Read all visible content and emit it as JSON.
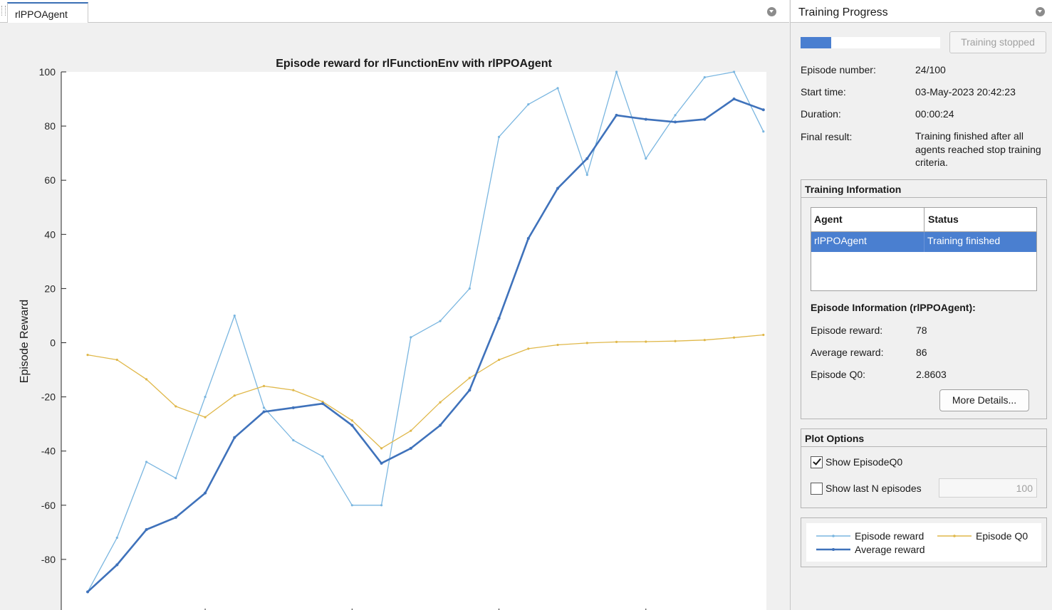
{
  "document": {
    "tab_label": "rlPPOAgent"
  },
  "chart_data": {
    "type": "line",
    "title": "Episode reward for rlFunctionEnv with rlPPOAgent",
    "xlabel": "",
    "ylabel": "Episode Reward",
    "ylim": [
      -100,
      100
    ],
    "xlim": [
      0,
      24
    ],
    "yticks": [
      100,
      80,
      60,
      40,
      20,
      0,
      -20,
      -40,
      -60,
      -80,
      -100
    ],
    "grid": false,
    "x": [
      1,
      2,
      3,
      4,
      5,
      6,
      7,
      8,
      9,
      10,
      11,
      12,
      13,
      14,
      15,
      16,
      17,
      18,
      19,
      20,
      21,
      22,
      23,
      24
    ],
    "series": [
      {
        "name": "Episode reward",
        "color": "#7ab6e0",
        "width": 1.3,
        "values": [
          -92,
          -72,
          -44,
          -50,
          -20,
          10,
          -24,
          -36,
          -42,
          -60,
          -60,
          2,
          8,
          20,
          76,
          88,
          94,
          62,
          100,
          68,
          84,
          98,
          100,
          78
        ]
      },
      {
        "name": "Average reward",
        "color": "#3f72bb",
        "width": 2.6,
        "values": [
          -92,
          -82,
          -69,
          -64.5,
          -55.5,
          -35,
          -25.5,
          -24,
          -22.5,
          -30.5,
          -44.5,
          -39,
          -30.5,
          -17.5,
          9,
          38.5,
          57,
          68,
          84,
          82.5,
          81.5,
          82.5,
          90,
          86
        ]
      },
      {
        "name": "Episode Q0",
        "color": "#e0b84a",
        "width": 1.3,
        "values": [
          -4.5,
          -6.3,
          -13.5,
          -23.5,
          -27.5,
          -19.5,
          -16,
          -17.5,
          -21.8,
          -28.7,
          -39,
          -32.5,
          -22,
          -13,
          -6.3,
          -2.2,
          -0.8,
          -0.1,
          0.3,
          0.4,
          0.6,
          1,
          1.9,
          2.9
        ]
      }
    ]
  },
  "training_progress": {
    "title": "Training Progress",
    "progress_fraction": 0.24,
    "stop_button_label": "Training stopped",
    "episode_number_label": "Episode number:",
    "episode_number_value": "24/100",
    "start_time_label": "Start time:",
    "start_time_value": "03-May-2023 20:42:23",
    "duration_label": "Duration:",
    "duration_value": "00:00:24",
    "final_result_label": "Final result:",
    "final_result_value": "Training finished after all agents reached stop training criteria."
  },
  "training_information": {
    "title": "Training Information",
    "columns": [
      "Agent",
      "Status"
    ],
    "rows": [
      {
        "agent": "rlPPOAgent",
        "status": "Training finished"
      }
    ],
    "episode_info_title": "Episode Information (rlPPOAgent):",
    "episode_reward_label": "Episode reward:",
    "episode_reward_value": "78",
    "average_reward_label": "Average reward:",
    "average_reward_value": "86",
    "episode_q0_label": "Episode Q0:",
    "episode_q0_value": "2.8603",
    "more_details_label": "More Details..."
  },
  "plot_options": {
    "title": "Plot Options",
    "show_q0_label": "Show EpisodeQ0",
    "show_q0_checked": true,
    "show_last_n_label": "Show last N episodes",
    "show_last_n_checked": false,
    "last_n_value": "100"
  },
  "legend": {
    "episode_reward": "Episode reward",
    "episode_q0": "Episode Q0",
    "average_reward": "Average reward"
  }
}
